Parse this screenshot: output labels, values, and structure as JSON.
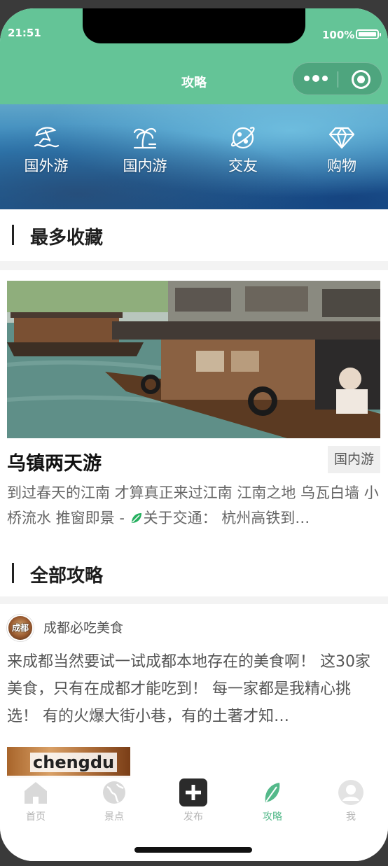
{
  "status_bar": {
    "time": "21:51",
    "battery": "100%"
  },
  "nav": {
    "title": "攻略"
  },
  "categories": [
    {
      "label": "国外游",
      "icon": "beach-umbrella-icon"
    },
    {
      "label": "国内游",
      "icon": "palm-tree-icon"
    },
    {
      "label": "交友",
      "icon": "planet-icon"
    },
    {
      "label": "购物",
      "icon": "diamond-icon"
    }
  ],
  "sections": {
    "most_favorited": "最多收藏",
    "all_guides": "全部攻略"
  },
  "featured": {
    "title": "乌镇两天游",
    "tag": "国内游",
    "description_part1": "到过春天的江南 才算真正来过江南 江南之地 乌瓦白墙 小桥流水 推窗即景 - ",
    "description_part2": "关于交通： 杭州高铁到…"
  },
  "article": {
    "author": "成都必吃美食",
    "avatar_text": "成都",
    "body": "来成都当然要试一试成都本地存在的美食啊！ 这30家美食，只有在成都才能吃到！ 每一家都是我精心挑选！ 有的火爆大街小巷，有的土著才知…",
    "thumb_text": "chengdu"
  },
  "tabbar": [
    {
      "label": "首页",
      "icon": "home-icon",
      "active": false
    },
    {
      "label": "景点",
      "icon": "globe-icon",
      "active": false
    },
    {
      "label": "发布",
      "icon": "add-icon",
      "active": false
    },
    {
      "label": "攻略",
      "icon": "leaf-icon",
      "active": true
    },
    {
      "label": "我",
      "icon": "profile-icon",
      "active": false
    }
  ],
  "colors": {
    "theme_green": "#64c497",
    "active_tab": "#54b98a",
    "inactive_tab": "#b5b5b5"
  }
}
